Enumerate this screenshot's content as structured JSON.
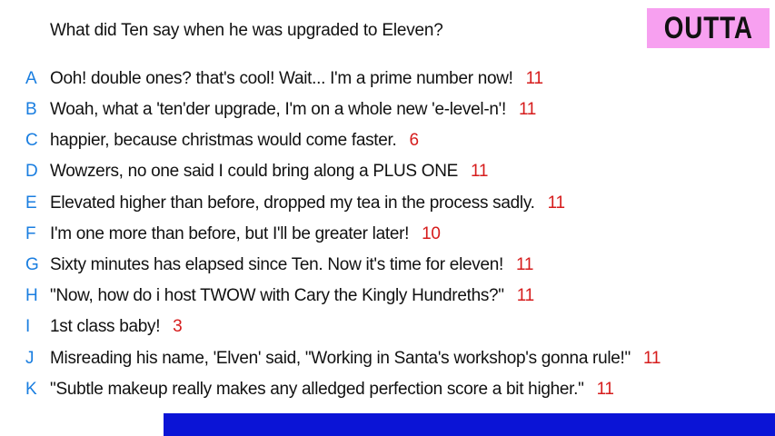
{
  "prompt": "What did Ten say when he was upgraded to Eleven?",
  "badge": "OUTTA",
  "responses": [
    {
      "letter": "A",
      "text": "Ooh! double ones? that's cool! Wait... I'm a prime number now!",
      "count": "11"
    },
    {
      "letter": "B",
      "text": "Woah, what a 'ten'der upgrade, I'm on a whole new 'e-level-n'!",
      "count": "11"
    },
    {
      "letter": "C",
      "text": "happier, because christmas would come faster.",
      "count": "6"
    },
    {
      "letter": "D",
      "text": "Wowzers, no one said I could bring along a PLUS ONE",
      "count": "11"
    },
    {
      "letter": "E",
      "text": "Elevated higher than before, dropped my tea in the process sadly.",
      "count": "11"
    },
    {
      "letter": "F",
      "text": "I'm one more than before, but I'll be greater later!",
      "count": "10"
    },
    {
      "letter": "G",
      "text": "Sixty minutes has elapsed since Ten. Now it's time for eleven!",
      "count": "11"
    },
    {
      "letter": "H",
      "text": "\"Now, how do i host TWOW with Cary the Kingly Hundreths?\"",
      "count": "11"
    },
    {
      "letter": "I",
      "text": "1st class baby!",
      "count": "3"
    },
    {
      "letter": "J",
      "text": "Misreading his name, 'Elven' said, \"Working in Santa's workshop's gonna rule!\"",
      "count": "11"
    },
    {
      "letter": "K",
      "text": "\"Subtle makeup really makes any alledged perfection score a bit higher.\"",
      "count": "11"
    }
  ],
  "colors": {
    "letter": "#1a7ee0",
    "count": "#d61c1c",
    "badge_bg": "#f7a0f0",
    "bottom_bar": "#0b14d6"
  }
}
